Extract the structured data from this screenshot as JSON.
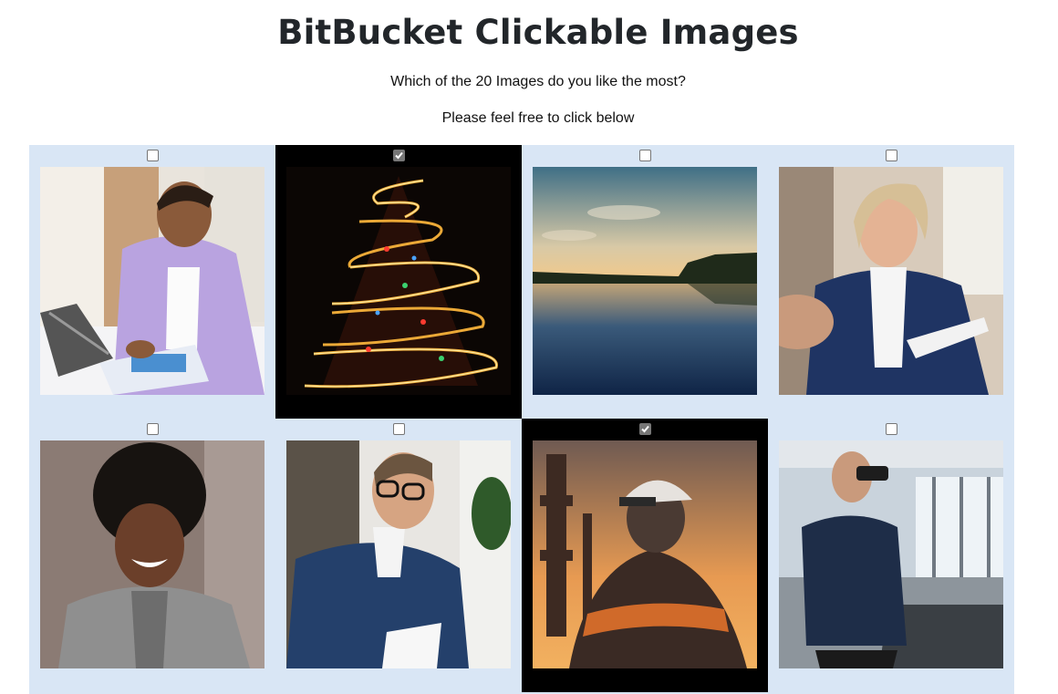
{
  "page": {
    "title": "BitBucket Clickable Images",
    "question": "Which of the 20 Images do you like the most?",
    "instruction": "Please feel free to click below"
  },
  "gallery": {
    "items": [
      {
        "subject": "woman-in-lavender-blazer-writing",
        "checked": false
      },
      {
        "subject": "sparkler-christmas-tree",
        "checked": true
      },
      {
        "subject": "lake-at-sunset",
        "checked": false
      },
      {
        "subject": "blonde-woman-in-navy-blazer",
        "checked": false
      },
      {
        "subject": "smiling-woman-gray-blazer",
        "checked": false
      },
      {
        "subject": "man-with-glasses-writing",
        "checked": false
      },
      {
        "subject": "worker-in-hardhat-refinery",
        "checked": true
      },
      {
        "subject": "officer-with-binoculars-on-bridge",
        "checked": false
      }
    ]
  },
  "colors": {
    "grid_background": "#d9e6f5",
    "selected_background": "#000000",
    "title_color": "#22262a"
  }
}
